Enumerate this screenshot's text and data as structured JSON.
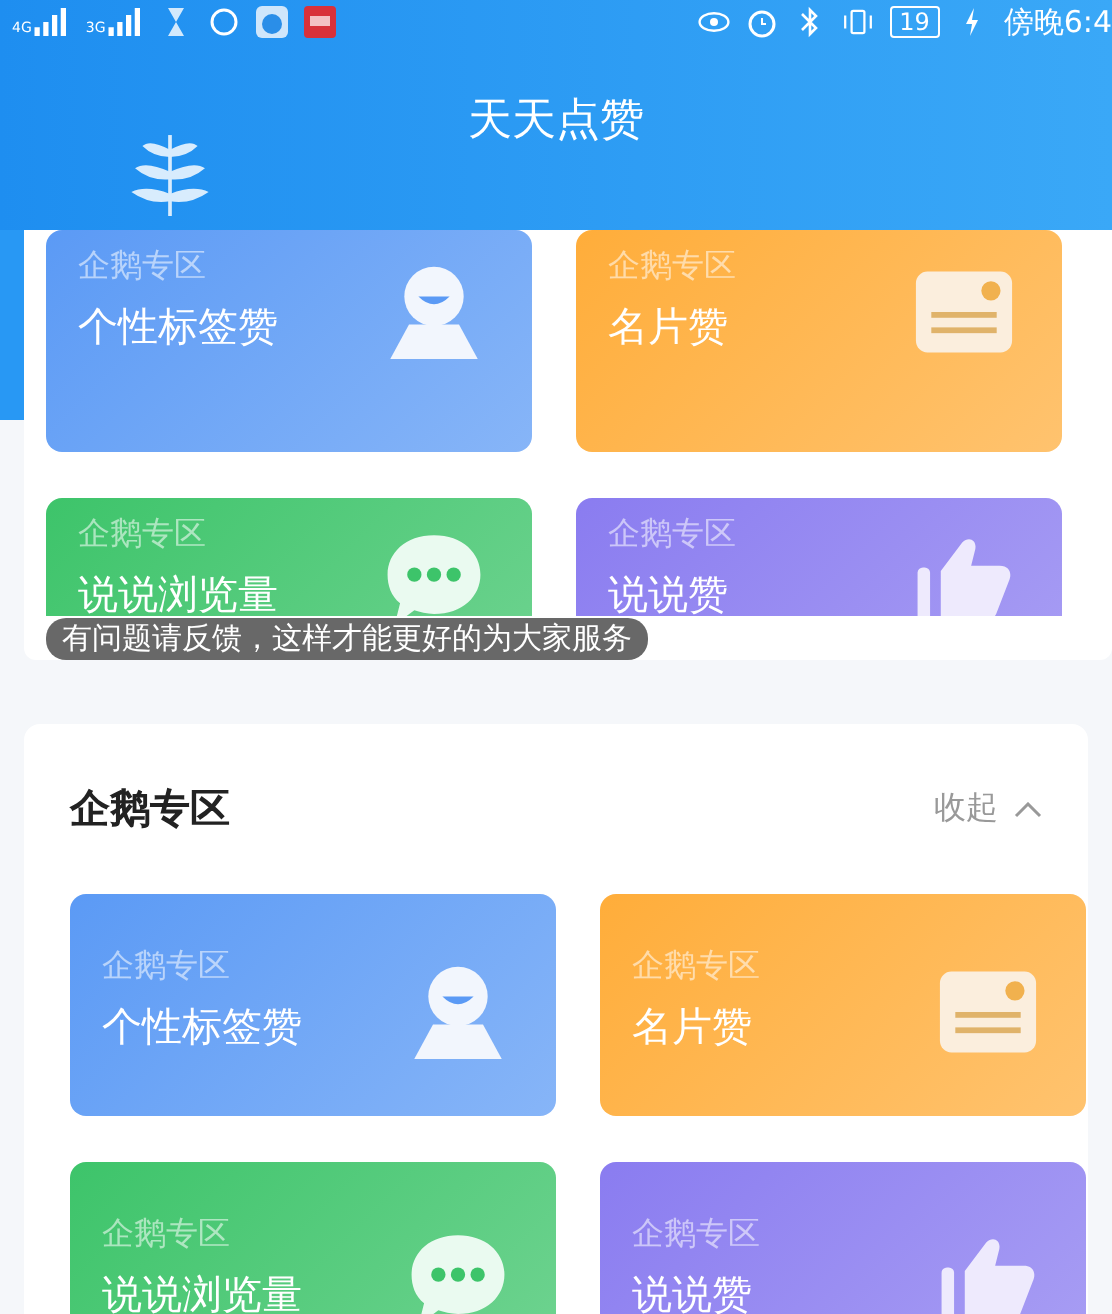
{
  "status_bar": {
    "signal_labels": [
      "4G",
      "3G"
    ],
    "battery": "19",
    "time": "傍晚6:4"
  },
  "header": {
    "title": "天天点赞"
  },
  "top_panel": {
    "tiles": [
      {
        "kind": "person",
        "tag": "企鹅专区",
        "title": "个性标签赞",
        "color": "#5b9af5"
      },
      {
        "kind": "card",
        "tag": "企鹅专区",
        "title": "名片赞",
        "color": "#ffad3a"
      },
      {
        "kind": "chat",
        "tag": "企鹅专区",
        "title": "说说浏览量",
        "color": "#3dc46a"
      },
      {
        "kind": "thumb",
        "tag": "企鹅专区",
        "title": "说说赞",
        "color": "#8a7cf0"
      }
    ]
  },
  "toast": "有问题请反馈，这样才能更好的为大家服务",
  "section": {
    "title": "企鹅专区",
    "toggle": "收起",
    "expanded": true,
    "tiles": [
      {
        "kind": "person",
        "tag": "企鹅专区",
        "title": "个性标签赞",
        "color": "#5b9af5"
      },
      {
        "kind": "card",
        "tag": "企鹅专区",
        "title": "名片赞",
        "color": "#ffad3a"
      },
      {
        "kind": "chat",
        "tag": "企鹅专区",
        "title": "说说浏览量",
        "color": "#3dc46a"
      },
      {
        "kind": "thumb",
        "tag": "企鹅专区",
        "title": "说说赞",
        "color": "#8a7cf0"
      }
    ]
  }
}
